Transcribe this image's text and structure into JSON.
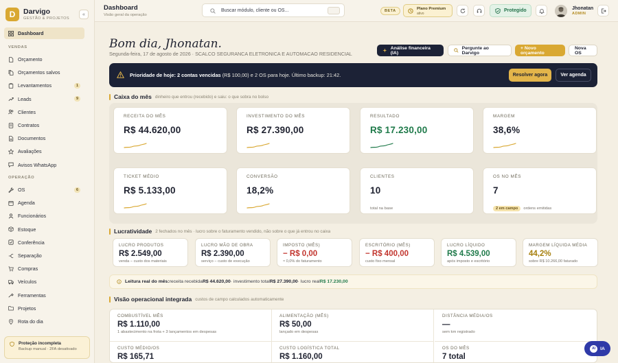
{
  "brand": {
    "initial": "D",
    "name": "Darvigo",
    "subtitle": "GESTÃO & PROJETOS",
    "collapse": "«"
  },
  "sidebar": {
    "dashboard": "Dashboard",
    "section_vendas": "VENDAS",
    "vendas": [
      {
        "label": "Orçamento",
        "icon": "file-icon"
      },
      {
        "label": "Orçamentos salvos",
        "icon": "files-icon"
      },
      {
        "label": "Levantamentos",
        "icon": "clipboard-icon",
        "badge": "1"
      },
      {
        "label": "Leads",
        "icon": "lead-icon",
        "badge": "9"
      },
      {
        "label": "Clientes",
        "icon": "users-icon"
      },
      {
        "label": "Contratos",
        "icon": "contract-icon"
      },
      {
        "label": "Documentos",
        "icon": "document-icon"
      },
      {
        "label": "Avaliações",
        "icon": "star-icon"
      },
      {
        "label": "Avisos WhatsApp",
        "icon": "chat-icon"
      }
    ],
    "section_operacao": "OPERAÇÃO",
    "operacao": [
      {
        "label": "OS",
        "icon": "wrench-icon",
        "badge": "6"
      },
      {
        "label": "Agenda",
        "icon": "calendar-icon"
      },
      {
        "label": "Funcionários",
        "icon": "team-icon"
      },
      {
        "label": "Estoque",
        "icon": "box-icon"
      },
      {
        "label": "Conferência",
        "icon": "check-icon"
      },
      {
        "label": "Separação",
        "icon": "split-icon"
      },
      {
        "label": "Compras",
        "icon": "cart-icon"
      },
      {
        "label": "Veículos",
        "icon": "truck-icon"
      },
      {
        "label": "Ferramentas",
        "icon": "tool-icon"
      },
      {
        "label": "Projetos",
        "icon": "folder-icon"
      },
      {
        "label": "Rota do dia",
        "icon": "pin-icon"
      }
    ],
    "protection": {
      "title": "Proteção incompleta",
      "subtitle": "Backup manual · 2FA desativado"
    }
  },
  "header": {
    "title": "Dashboard",
    "subtitle": "Visão geral da operação",
    "search_placeholder": "Buscar módulo, cliente ou OS...",
    "beta": "BETA",
    "premium_title": "Plano Premium",
    "premium_sub": "ativo",
    "protected": "Protegido",
    "user_name": "Jhonatan",
    "user_role": "ADMIN"
  },
  "greeting": {
    "title": "Bom dia, Jhonatan.",
    "subtitle": "Segunda-feira, 17 de agosto de 2026 · SCALCO SEGURANCA ELETRONICA E AUTOMACAO RESIDENCIAL"
  },
  "actions": {
    "ai_analysis": "Análise financeira (IA)",
    "ask": "Pergunte ao Darvigo",
    "new_quote": "+ Novo orçamento",
    "new_os": "Nova OS"
  },
  "banner": {
    "lead": "Prioridade de hoje: 2 contas vencidas",
    "rest": " (R$ 100,00) e 2 OS para hoje. Último backup: 21:42.",
    "resolve": "Resolver agora",
    "agenda": "Ver agenda"
  },
  "caixa": {
    "title": "Caixa do mês",
    "subtitle": "dinheiro que entrou (recebido) e saiu: o que sobra no bolso",
    "cards": [
      {
        "label": "RECEITA DO MÊS",
        "value": "R$ 44.620,00"
      },
      {
        "label": "INVESTIMENTO DO MÊS",
        "value": "R$ 27.390,00"
      },
      {
        "label": "RESULTADO",
        "value": "R$ 17.230,00"
      },
      {
        "label": "MARGEM",
        "value": "38,6%"
      },
      {
        "label": "TICKET MÉDIO",
        "value": "R$ 5.133,00"
      },
      {
        "label": "CONVERSÃO",
        "value": "18,2%"
      },
      {
        "label": "CLIENTES",
        "value": "10",
        "foot": "total na base"
      },
      {
        "label": "OS NO MÊS",
        "value": "7",
        "badge": "2 em campo",
        "foot": "ordens emitidas"
      }
    ]
  },
  "lucratividade": {
    "title": "Lucratividade",
    "subtitle": "2 fechados no mês · lucro sobre o faturamento vendido, não sobre o que já entrou no caixa",
    "cards": [
      {
        "label": "LUCRO PRODUTOS",
        "value": "R$ 2.549,00",
        "sub": "venda − custo dos materiais"
      },
      {
        "label": "LUCRO MÃO DE OBRA",
        "value": "R$ 2.390,00",
        "sub": "serviço − custo de execução"
      },
      {
        "label": "IMPOSTO (MÊS)",
        "value": "− R$ 0,00",
        "sub": "≈ 0,0% do faturamento"
      },
      {
        "label": "ESCRITÓRIO (MÊS)",
        "value": "− R$ 400,00",
        "sub": "custo fixo mensal"
      },
      {
        "label": "LUCRO LÍQUIDO",
        "value": "R$ 4.539,00",
        "sub": "após imposto e escritório"
      },
      {
        "label": "MARGEM LÍQUIDA MÉDIA",
        "value": "44,2%",
        "sub": "sobre R$ 10.266,00 faturado"
      }
    ],
    "leitura_label": "Leitura real do mês:",
    "leitura_a": " receita recebida ",
    "leitura_receita": "R$ 44.620,00",
    "leitura_b": " · investimento total ",
    "leitura_invest": "R$ 27.390,00",
    "leitura_c": " · lucro real ",
    "leitura_lucro": "R$ 17.230,00"
  },
  "operacional": {
    "title": "Visão operacional integrada",
    "subtitle": "custos de campo calculados automaticamente",
    "cells": [
      {
        "label": "COMBUSTÍVEL MÊS",
        "value": "R$ 1.110,00",
        "sub": "1 abastecimento na frota + 3 lançamentos em despesas"
      },
      {
        "label": "ALIMENTAÇÃO (MÊS)",
        "value": "R$ 50,00",
        "sub": "lançado em despesas"
      },
      {
        "label": "DISTÂNCIA MÉDIA/OS",
        "value": "—",
        "sub": "sem km registrado"
      },
      {
        "label": "CUSTO MÉDIO/OS",
        "value": "R$ 165,71",
        "sub": ""
      },
      {
        "label": "CUSTO LOGÍSTICA TOTAL",
        "value": "R$ 1.160,00",
        "sub": ""
      },
      {
        "label": "OS DO MÊS",
        "value": "7 total",
        "sub": ""
      }
    ]
  },
  "ia_button": {
    "dot": "AI",
    "label": "IA"
  },
  "colors": {
    "gold": "#d9a832",
    "navy": "#1c2236",
    "green": "#1f7a4a",
    "red": "#c2352e"
  }
}
